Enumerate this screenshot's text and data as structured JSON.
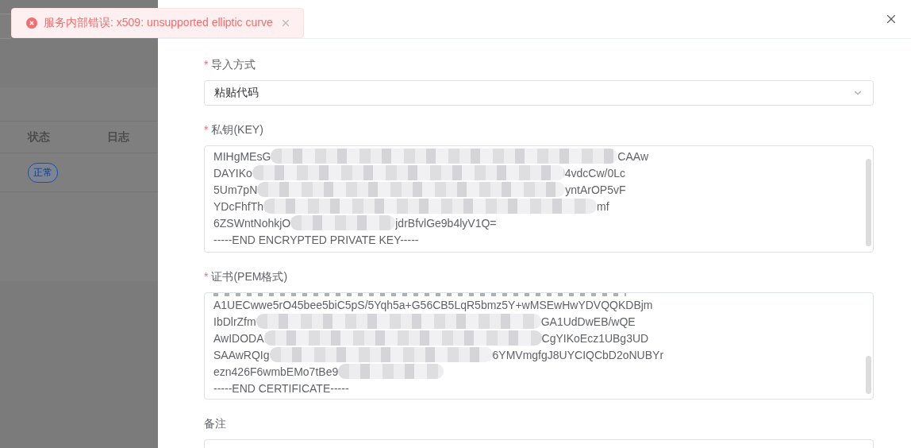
{
  "toast": {
    "kind": "error",
    "message": "服务内部错误: x509: unsupported elliptic curve"
  },
  "background_table": {
    "columns": [
      "状态",
      "日志"
    ],
    "rows": [
      {
        "status": "正常"
      }
    ]
  },
  "drawer": {
    "fields": [
      {
        "kind": "select",
        "label": "导入方式",
        "required_mark": "*",
        "value": "粘贴代码"
      },
      {
        "kind": "textarea",
        "label": "私钥(KEY)",
        "required_mark": "*",
        "cut_top": false,
        "lines": [
          {
            "parts": [
              "MIHgMEsG",
              "CAAw"
            ]
          },
          {
            "parts": [
              "DAYIKo",
              "4vdcCw/0Lc"
            ]
          },
          {
            "parts": [
              "5Um7pN",
              "yntArOP5vF"
            ]
          },
          {
            "parts": [
              "YDcFhfTh",
              "mf"
            ]
          },
          {
            "parts": [
              "6ZSWntNohkjO",
              "jdrBfvlGe9b4lyV1Q="
            ]
          },
          {
            "parts": [
              "-----END ENCRYPTED PRIVATE KEY-----"
            ]
          }
        ]
      },
      {
        "kind": "textarea",
        "label": "证书(PEM格式)",
        "required_mark": "*",
        "cut_top": true,
        "lines": [
          {
            "parts": [
              "A1UECwwe5rO45bee5biC5pS/5Yqh5a+G56CB5LqR5bmz5Y+wMSEwHwYDVQQKDBjm"
            ]
          },
          {
            "parts": [
              "IbDlrZfm",
              "GA1UdDwEB/wQE"
            ]
          },
          {
            "parts": [
              "AwIDODA",
              "CgYIKoEcz1UBg3UD"
            ]
          },
          {
            "parts": [
              "SAAwRQIg",
              "6YMVmgfgJ8UYCIQCbD2oNUBYr"
            ]
          },
          {
            "parts": [
              "ezn426F6wmbEMo7tBe9"
            ],
            "blurred_tail": true
          },
          {
            "parts": [
              "-----END CERTIFICATE-----"
            ]
          }
        ]
      },
      {
        "kind": "input",
        "label": "备注"
      }
    ]
  }
}
